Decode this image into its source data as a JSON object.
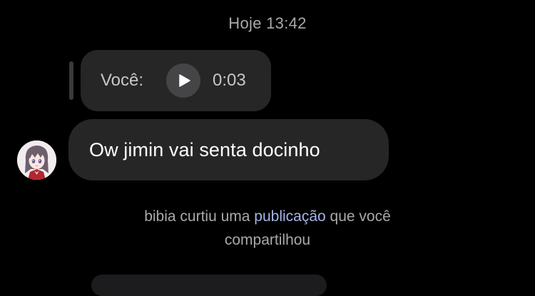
{
  "chat": {
    "timestamp": "Hoje 13:42",
    "voice_message": {
      "sender_label": "Você:",
      "duration": "0:03"
    },
    "incoming_message": {
      "text": "Ow jimin vai senta docinho"
    },
    "activity_notice": {
      "prefix": "bibia curtiu uma",
      "link_text": "publicação",
      "suffix_line1": "que você",
      "line2": "compartilhou"
    }
  },
  "icons": {
    "play": "play-icon",
    "avatar": "anime-avatar"
  },
  "colors": {
    "background": "#000000",
    "bubble": "#262626",
    "muted_text": "#a9a9ad",
    "link": "#a5b4e8"
  }
}
